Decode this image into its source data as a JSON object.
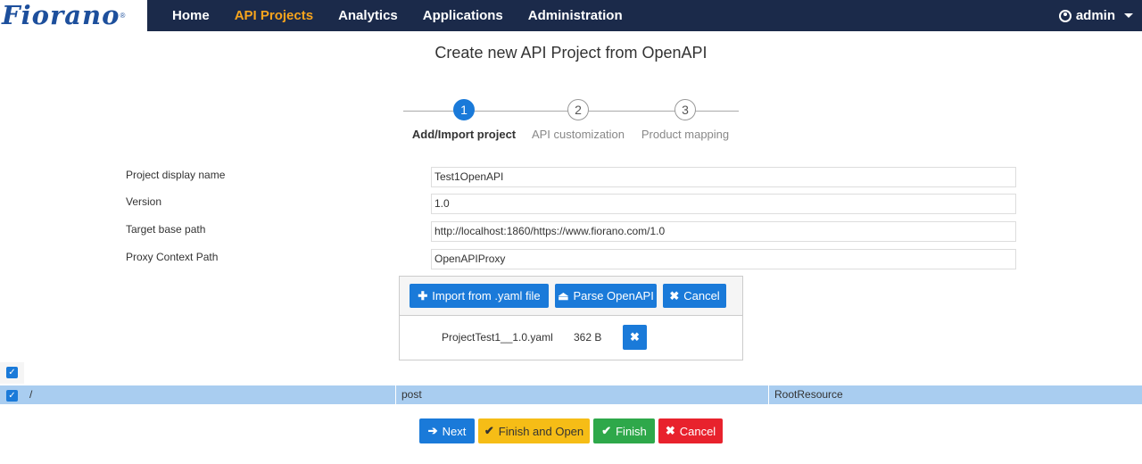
{
  "brand": {
    "logo": "Fiorano",
    "reg": "®"
  },
  "nav": {
    "items": [
      {
        "label": "Home",
        "active": false
      },
      {
        "label": "API Projects",
        "active": true
      },
      {
        "label": "Analytics",
        "active": false
      },
      {
        "label": "Applications",
        "active": false
      },
      {
        "label": "Administration",
        "active": false
      }
    ],
    "user": "admin"
  },
  "page": {
    "title": "Create new API Project from OpenAPI"
  },
  "stepper": {
    "steps": [
      {
        "num": "1",
        "label": "Add/Import project",
        "active": true
      },
      {
        "num": "2",
        "label": "API customization",
        "active": false
      },
      {
        "num": "3",
        "label": "Product mapping",
        "active": false
      }
    ]
  },
  "form": {
    "project_display_name": {
      "label": "Project display name",
      "value": "Test1OpenAPI"
    },
    "version": {
      "label": "Version",
      "value": "1.0"
    },
    "target_base_path": {
      "label": "Target base path",
      "value": "http://localhost:1860/https://www.fiorano.com/1.0"
    },
    "proxy_context_path": {
      "label": "Proxy Context Path",
      "value": "OpenAPIProxy"
    }
  },
  "upload": {
    "import_label": "Import from .yaml file",
    "parse_label": "Parse OpenAPI",
    "cancel_label": "Cancel",
    "file": {
      "name": "ProjectTest1__1.0.yaml",
      "size": "362 B"
    }
  },
  "table": {
    "rows": [
      {
        "path": "/",
        "method": "post",
        "resource": "RootResource"
      }
    ]
  },
  "actions": {
    "next": "Next",
    "finish_open": "Finish and Open",
    "finish": "Finish",
    "cancel": "Cancel"
  },
  "colors": {
    "nav_bg": "#1b2a4a",
    "nav_active": "#f7a41d",
    "primary": "#1a7ad9",
    "warning": "#f6bd16",
    "success": "#2ea84a",
    "danger": "#e8222d",
    "row_selected": "#a9cdf0"
  }
}
